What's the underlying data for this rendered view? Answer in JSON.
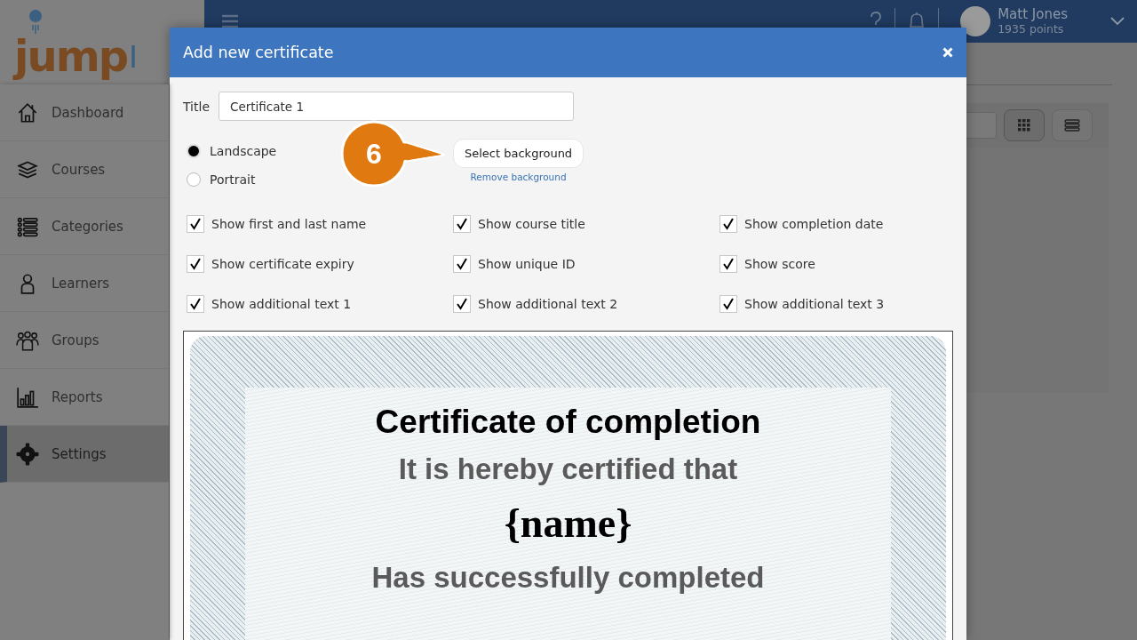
{
  "app": {
    "logo": {
      "text": "jump",
      "text_cut": "I"
    },
    "sidebar": {
      "items": [
        {
          "label": "Dashboard",
          "selected": false
        },
        {
          "label": "Courses",
          "selected": false
        },
        {
          "label": "Categories",
          "selected": false
        },
        {
          "label": "Learners",
          "selected": false
        },
        {
          "label": "Groups",
          "selected": false
        },
        {
          "label": "Reports",
          "selected": false
        },
        {
          "label": "Settings",
          "selected": true
        }
      ]
    },
    "topbar": {
      "user": {
        "name": "Matt Jones",
        "points": "1935 points"
      }
    }
  },
  "dialog": {
    "title": "Add new certificate",
    "title_label": "Title",
    "title_value": "Certificate 1",
    "orientation": [
      {
        "label": "Landscape",
        "selected": true
      },
      {
        "label": "Portrait",
        "selected": false
      }
    ],
    "background_button": "Select background",
    "remove_link": "Remove background",
    "callout": "6",
    "options": [
      {
        "label": "Show first and last name",
        "checked": true
      },
      {
        "label": "Show course title",
        "checked": true
      },
      {
        "label": "Show completion date",
        "checked": true
      },
      {
        "label": "Show certificate expiry",
        "checked": true
      },
      {
        "label": "Show unique ID",
        "checked": true
      },
      {
        "label": "Show score",
        "checked": true
      },
      {
        "label": "Show additional text 1",
        "checked": true
      },
      {
        "label": "Show additional text 2",
        "checked": true
      },
      {
        "label": "Show additional text 3",
        "checked": true
      }
    ],
    "preview": {
      "lines": [
        {
          "kind": "heading",
          "text": "Certificate of completion"
        },
        {
          "kind": "subheading",
          "text": "It is hereby certified that"
        },
        {
          "kind": "placeholder",
          "text": "{name}"
        },
        {
          "kind": "subheading",
          "text": "Has successfully completed"
        }
      ]
    }
  }
}
